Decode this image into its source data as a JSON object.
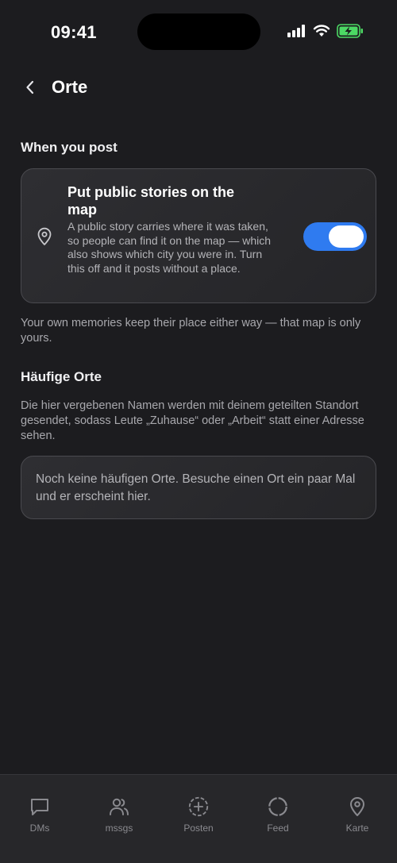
{
  "status_bar": {
    "time": "09:41"
  },
  "header": {
    "title": "Orte"
  },
  "when_you_post": {
    "section_title": "When you post",
    "card": {
      "heading": "Put public stories on the map",
      "description": "A public story carries where it was taken, so people can find it on the map — which also shows which city you were in. Turn this off and it posts without a place.",
      "toggle_on": true
    },
    "note": "Your own memories keep their place either way — that map is only yours."
  },
  "frequent_places": {
    "section_title": "Häufige Orte",
    "description": "Die hier vergebenen Namen werden mit deinem geteilten Standort gesendet, sodass Leute „Zuhause“ oder „Arbeit“ statt einer Adresse sehen.",
    "empty_text": "Noch keine häufigen Orte. Besuche einen Ort ein paar Mal und er erscheint hier."
  },
  "tab_bar": {
    "tabs": [
      {
        "label": "DMs",
        "icon": "chat-bubble-icon"
      },
      {
        "label": "mssgs",
        "icon": "people-icon"
      },
      {
        "label": "Posten",
        "icon": "plus-circle-icon"
      },
      {
        "label": "Feed",
        "icon": "circle-icon"
      },
      {
        "label": "Karte",
        "icon": "map-pin-icon"
      }
    ]
  },
  "colors": {
    "background": "#1c1c1f",
    "accent": "#2f7bf0",
    "battery": "#4cd964"
  }
}
